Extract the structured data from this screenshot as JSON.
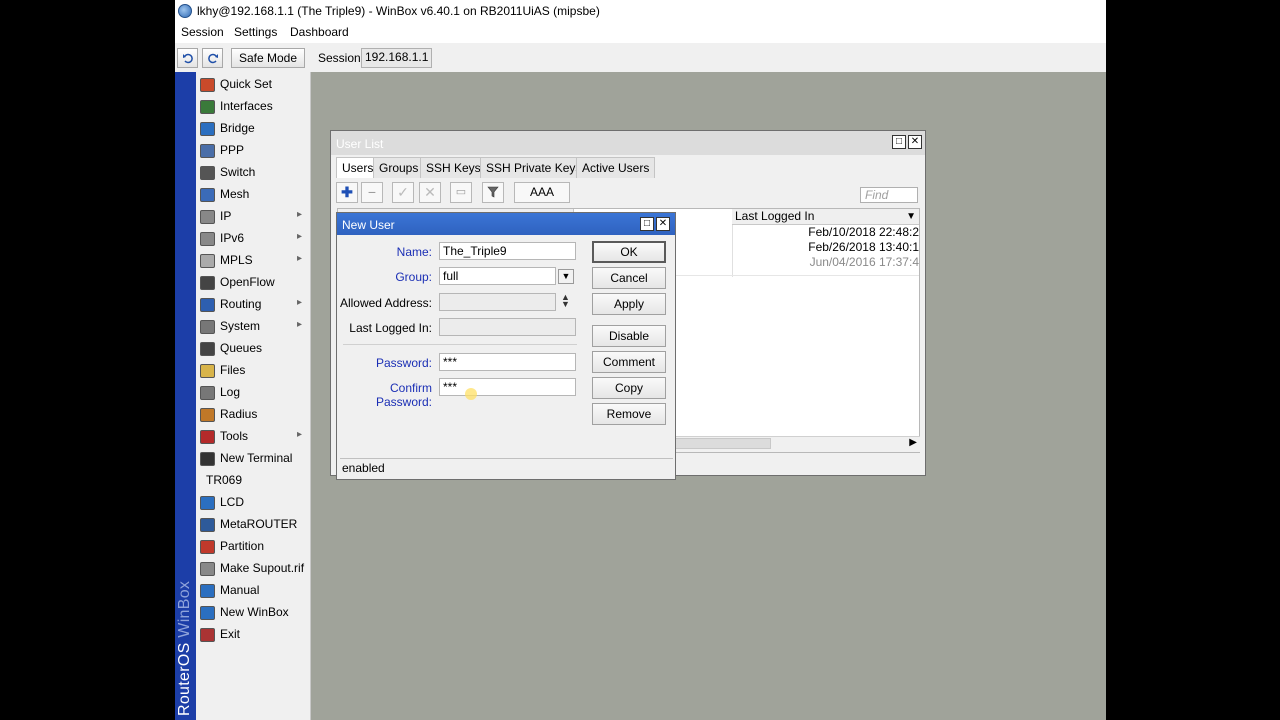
{
  "titlebar": {
    "title": "lkhy@192.168.1.1 (The Triple9) - WinBox v6.40.1 on RB2011UiAS (mipsbe)"
  },
  "menu": [
    "Session",
    "Settings",
    "Dashboard"
  ],
  "toolbar": {
    "undo_icon": "undo-icon",
    "redo_icon": "redo-icon",
    "safe_mode": "Safe Mode",
    "session_label": "Session:",
    "session_value": "192.168.1.1"
  },
  "brand": {
    "word1": "RouterOS",
    "word2": "WinBox"
  },
  "sidebar": {
    "items": [
      {
        "label": "Quick Set",
        "icon": "quick-set-icon",
        "submenu": false
      },
      {
        "label": "Interfaces",
        "icon": "interfaces-icon",
        "submenu": false
      },
      {
        "label": "Bridge",
        "icon": "bridge-icon",
        "submenu": false
      },
      {
        "label": "PPP",
        "icon": "ppp-icon",
        "submenu": false
      },
      {
        "label": "Switch",
        "icon": "switch-icon",
        "submenu": false
      },
      {
        "label": "Mesh",
        "icon": "mesh-icon",
        "submenu": false
      },
      {
        "label": "IP",
        "icon": "ip-icon",
        "submenu": true
      },
      {
        "label": "IPv6",
        "icon": "ipv6-icon",
        "submenu": true
      },
      {
        "label": "MPLS",
        "icon": "mpls-icon",
        "submenu": true
      },
      {
        "label": "OpenFlow",
        "icon": "openflow-icon",
        "submenu": false
      },
      {
        "label": "Routing",
        "icon": "routing-icon",
        "submenu": true
      },
      {
        "label": "System",
        "icon": "system-icon",
        "submenu": true
      },
      {
        "label": "Queues",
        "icon": "queues-icon",
        "submenu": false
      },
      {
        "label": "Files",
        "icon": "files-icon",
        "submenu": false
      },
      {
        "label": "Log",
        "icon": "log-icon",
        "submenu": false
      },
      {
        "label": "Radius",
        "icon": "radius-icon",
        "submenu": false
      },
      {
        "label": "Tools",
        "icon": "tools-icon",
        "submenu": true
      },
      {
        "label": "New Terminal",
        "icon": "terminal-icon",
        "submenu": false
      },
      {
        "label": "TR069",
        "icon": "",
        "submenu": false
      },
      {
        "label": "LCD",
        "icon": "lcd-icon",
        "submenu": false
      },
      {
        "label": "MetaROUTER",
        "icon": "metarouter-icon",
        "submenu": false
      },
      {
        "label": "Partition",
        "icon": "partition-icon",
        "submenu": false
      },
      {
        "label": "Make Supout.rif",
        "icon": "supout-icon",
        "submenu": false
      },
      {
        "label": "Manual",
        "icon": "manual-icon",
        "submenu": false
      },
      {
        "label": "New WinBox",
        "icon": "winbox-icon",
        "submenu": false
      },
      {
        "label": "Exit",
        "icon": "exit-icon",
        "submenu": false
      }
    ]
  },
  "user_list": {
    "title": "User List",
    "tabs": [
      "Users",
      "Groups",
      "SSH Keys",
      "SSH Private Keys",
      "Active Users"
    ],
    "active_tab": "Users",
    "toolbar": {
      "aaa": "AAA",
      "find_placeholder": "Find"
    },
    "column_last_logged_in": "Last Logged In",
    "rows": [
      {
        "last_logged_in": "Feb/10/2018 22:48:2",
        "disabled": false
      },
      {
        "last_logged_in": "Feb/26/2018 13:40:1",
        "disabled": false
      },
      {
        "last_logged_in": "Jun/04/2016 17:37:4",
        "disabled": true
      }
    ]
  },
  "new_user": {
    "title": "New User",
    "fields": {
      "name_label": "Name:",
      "name_value": "The_Triple9",
      "group_label": "Group:",
      "group_value": "full",
      "allowed_address_label": "Allowed Address:",
      "allowed_address_value": "",
      "last_logged_in_label": "Last Logged In:",
      "last_logged_in_value": "",
      "password_label": "Password:",
      "password_value": "***",
      "confirm_password_label": "Confirm Password:",
      "confirm_password_value": "***"
    },
    "buttons": {
      "ok": "OK",
      "cancel": "Cancel",
      "apply": "Apply",
      "disable": "Disable",
      "comment": "Comment",
      "copy": "Copy",
      "remove": "Remove"
    },
    "status": "enabled"
  },
  "colors": {
    "accent": "#2f62c0",
    "brand_stripe": "#1c3ea8",
    "label_blue": "#1b2fb5",
    "workspace": "#a0a39a"
  }
}
